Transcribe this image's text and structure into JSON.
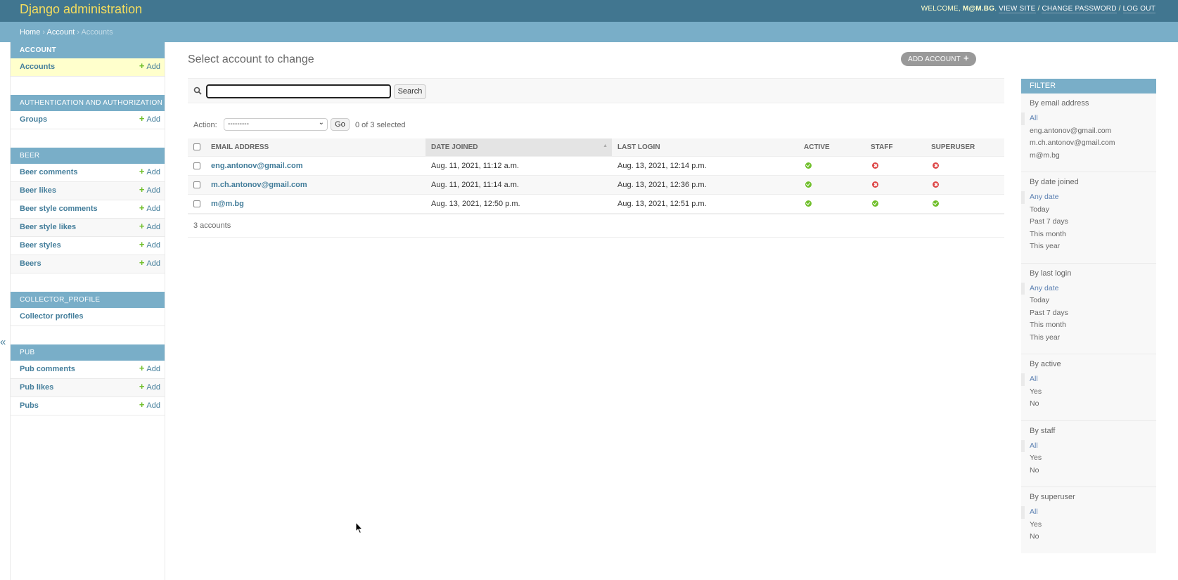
{
  "header": {
    "branding": "Django administration",
    "welcome": "Welcome,",
    "username": "M@M.BG",
    "links": [
      "View site",
      "Change password",
      "Log out"
    ]
  },
  "breadcrumbs": {
    "home": "Home",
    "app": "Account",
    "current": "Accounts"
  },
  "sidebar": {
    "toggle": "«",
    "add_label": "Add",
    "modules": [
      {
        "caption": "Account",
        "items": [
          {
            "label": "Accounts",
            "add": true,
            "current": true
          }
        ]
      },
      {
        "caption": "Authentication and Authorization",
        "items": [
          {
            "label": "Groups",
            "add": true
          }
        ]
      },
      {
        "caption": "Beer",
        "items": [
          {
            "label": "Beer comments",
            "add": true
          },
          {
            "label": "Beer likes",
            "add": true
          },
          {
            "label": "Beer style comments",
            "add": true
          },
          {
            "label": "Beer style likes",
            "add": true
          },
          {
            "label": "Beer styles",
            "add": true
          },
          {
            "label": "Beers",
            "add": true
          }
        ]
      },
      {
        "caption": "Collector_profile",
        "items": [
          {
            "label": "Collector profiles",
            "add": false
          }
        ]
      },
      {
        "caption": "Pub",
        "items": [
          {
            "label": "Pub comments",
            "add": true
          },
          {
            "label": "Pub likes",
            "add": true
          },
          {
            "label": "Pubs",
            "add": true
          }
        ]
      }
    ]
  },
  "main": {
    "title": "Select account to change",
    "add_button": "Add account",
    "search": {
      "value": "",
      "placeholder": "",
      "button": "Search"
    },
    "actions": {
      "label": "Action:",
      "selected": "---------",
      "go": "Go",
      "counter": "0 of 3 selected"
    },
    "table": {
      "columns": [
        "Email address",
        "Date joined",
        "Last login",
        "Active",
        "Staff",
        "Superuser"
      ],
      "sorted_column": "Date joined",
      "rows": [
        {
          "email": "eng.antonov@gmail.com",
          "date_joined": "Aug. 11, 2021, 11:12 a.m.",
          "last_login": "Aug. 13, 2021, 12:14 p.m.",
          "active": true,
          "staff": false,
          "superuser": false
        },
        {
          "email": "m.ch.antonov@gmail.com",
          "date_joined": "Aug. 11, 2021, 11:14 a.m.",
          "last_login": "Aug. 13, 2021, 12:36 p.m.",
          "active": true,
          "staff": false,
          "superuser": false
        },
        {
          "email": "m@m.bg",
          "date_joined": "Aug. 13, 2021, 12:50 p.m.",
          "last_login": "Aug. 13, 2021, 12:51 p.m.",
          "active": true,
          "staff": true,
          "superuser": true
        }
      ]
    },
    "paginator": "3 accounts"
  },
  "filter": {
    "title": "Filter",
    "groups": [
      {
        "title": "By email address",
        "options": [
          "All",
          "eng.antonov@gmail.com",
          "m.ch.antonov@gmail.com",
          "m@m.bg"
        ],
        "selected": 0
      },
      {
        "title": "By date joined",
        "options": [
          "Any date",
          "Today",
          "Past 7 days",
          "This month",
          "This year"
        ],
        "selected": 0
      },
      {
        "title": "By last login",
        "options": [
          "Any date",
          "Today",
          "Past 7 days",
          "This month",
          "This year"
        ],
        "selected": 0
      },
      {
        "title": "By active",
        "options": [
          "All",
          "Yes",
          "No"
        ],
        "selected": 0
      },
      {
        "title": "By staff",
        "options": [
          "All",
          "Yes",
          "No"
        ],
        "selected": 0
      },
      {
        "title": "By superuser",
        "options": [
          "All",
          "Yes",
          "No"
        ],
        "selected": 0
      }
    ]
  },
  "colors": {
    "header": "#417690",
    "accent": "#79aec8",
    "branding": "#f5dd5d",
    "link": "#447e9b",
    "yes": "#70bf2b",
    "no": "#dd4646"
  }
}
